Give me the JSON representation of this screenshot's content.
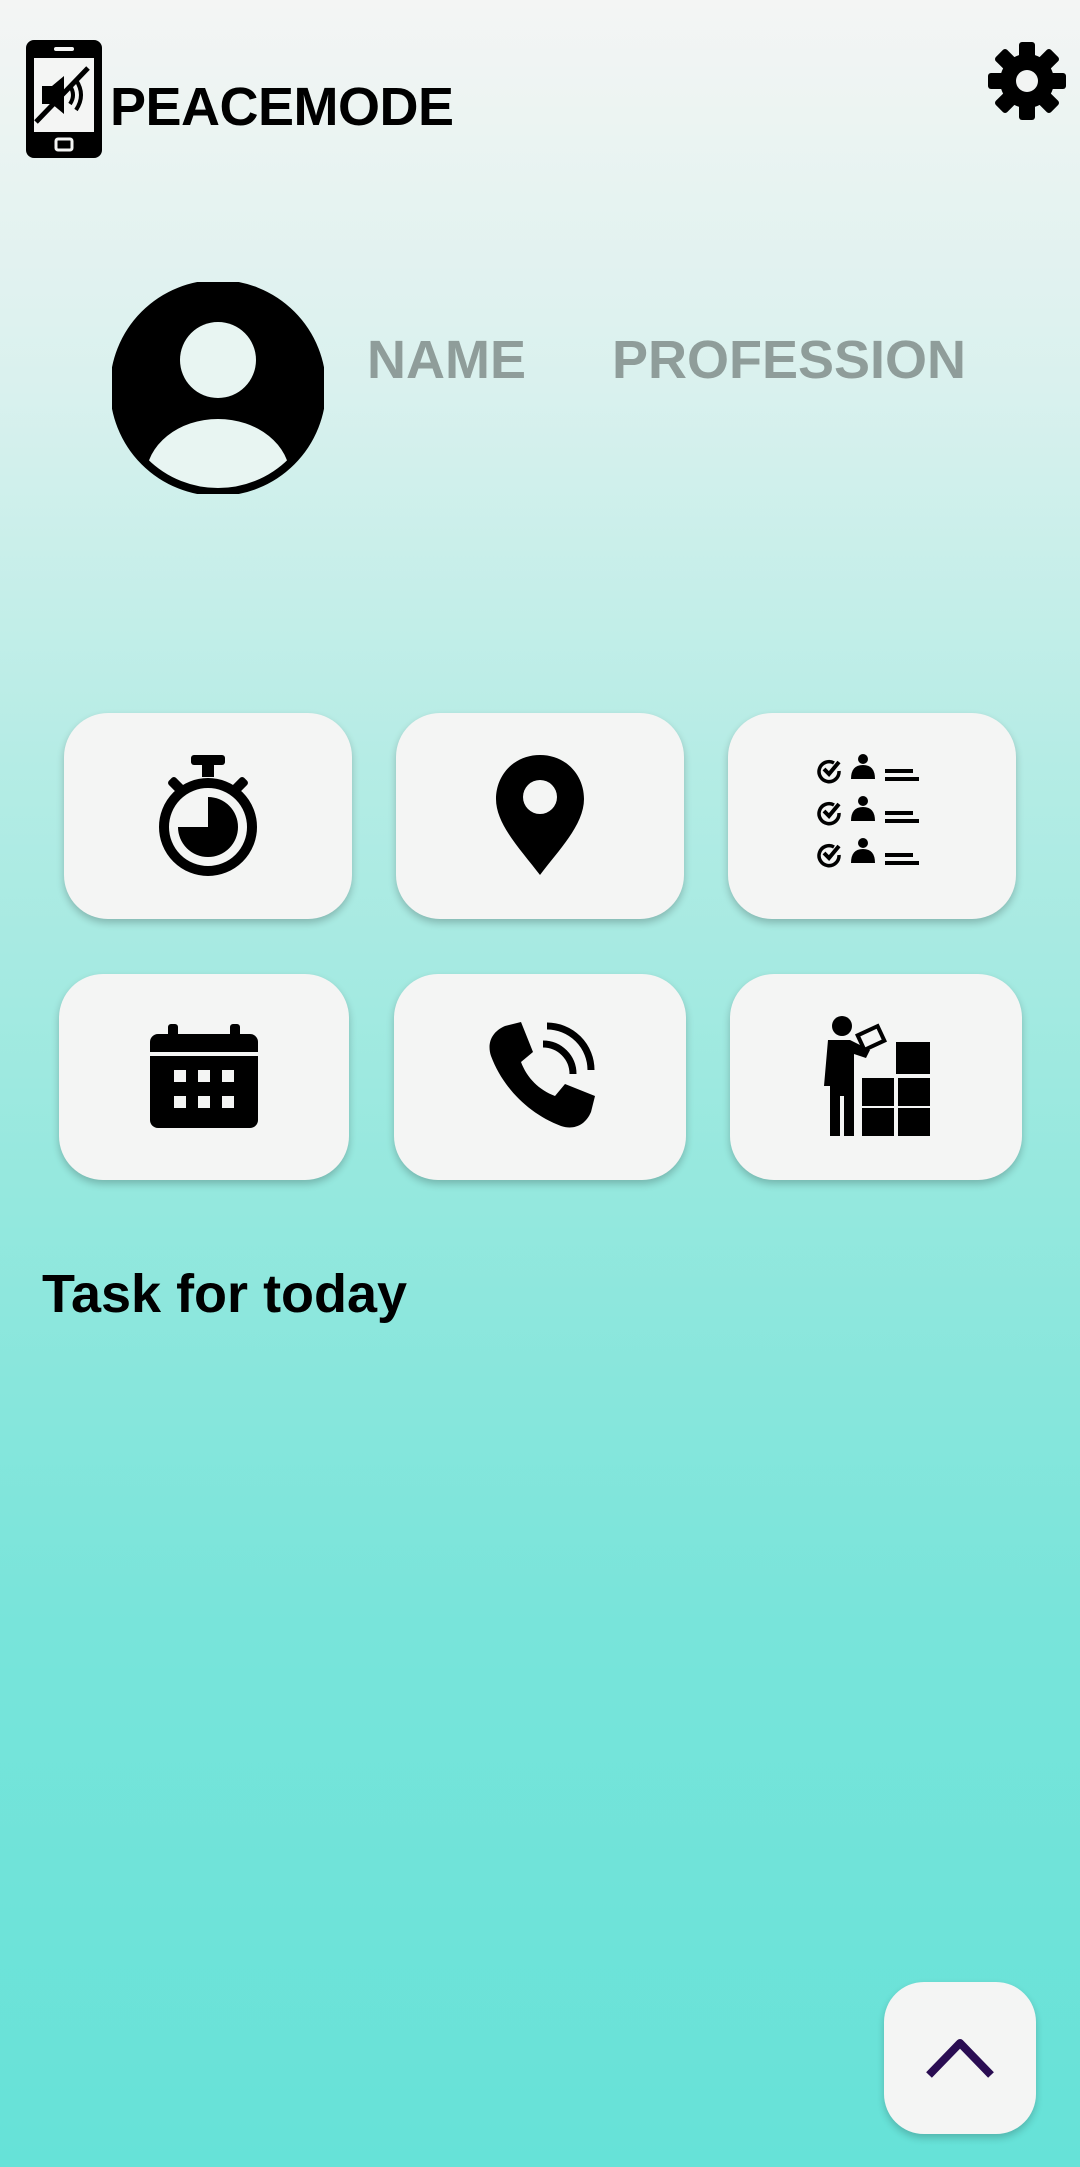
{
  "app": {
    "title": "PEACEMODE",
    "logo_icon": "phone-muted-icon"
  },
  "header": {
    "settings_icon": "gear-icon"
  },
  "profile": {
    "name": "NAME",
    "profession": "PROFESSION",
    "avatar_icon": "user-avatar-icon"
  },
  "shortcuts": [
    {
      "icon": "stopwatch-icon"
    },
    {
      "icon": "location-pin-icon"
    },
    {
      "icon": "attendance-checklist-icon"
    },
    {
      "icon": "calendar-icon"
    },
    {
      "icon": "phone-call-icon"
    },
    {
      "icon": "inventory-worker-icon"
    }
  ],
  "tasks": {
    "title": "Task for today",
    "items": []
  },
  "fab": {
    "icon": "chevron-up-icon"
  },
  "colors": {
    "background_top": "#f4f5f4",
    "background_bottom": "#66e2d8",
    "tile": "#f4f5f4",
    "profile_text": "#8f9d9a",
    "fab_chevron": "#2a0d52"
  }
}
